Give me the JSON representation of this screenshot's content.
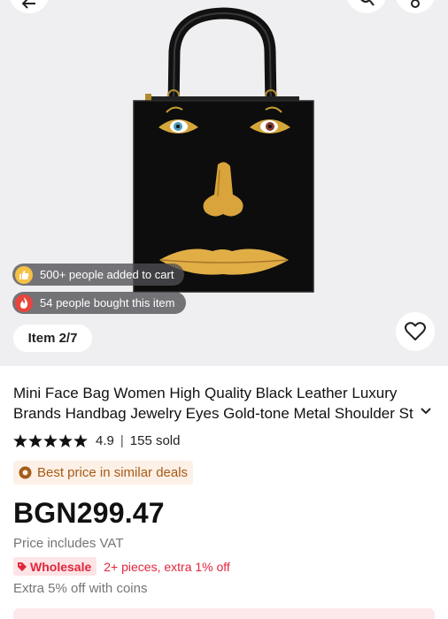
{
  "gallery": {
    "social": {
      "added_to_cart": "500+ people added to cart",
      "bought": "54 people bought this item"
    },
    "counter": "Item 2/7"
  },
  "product": {
    "title_line1": "Mini Face Bag Women High Quality Black Leather Luxury",
    "title_line2": "Brands Handbag Jewelry Eyes Gold-tone Metal Shoulder St",
    "rating": "4.9",
    "rating_stars": 4.9,
    "separator": "|",
    "sold": "155 sold",
    "best_price": "Best price in similar deals",
    "price": "BGN299.47",
    "vat_note": "Price includes VAT",
    "wholesale_label": "Wholesale",
    "wholesale_offer": "2+ pieces, extra 1% off",
    "coins_offer": "Extra 5% off with coins"
  },
  "colors": {
    "accent_red": "#e0263c",
    "best_price_text": "#a65b19",
    "gallery_bg": "#efeff1"
  },
  "icons": [
    "back-icon",
    "search-icon",
    "share-icon",
    "thumbs-up-icon",
    "fire-icon",
    "heart-icon",
    "star-icon",
    "chevron-down-icon",
    "coin-icon",
    "tag-icon"
  ]
}
